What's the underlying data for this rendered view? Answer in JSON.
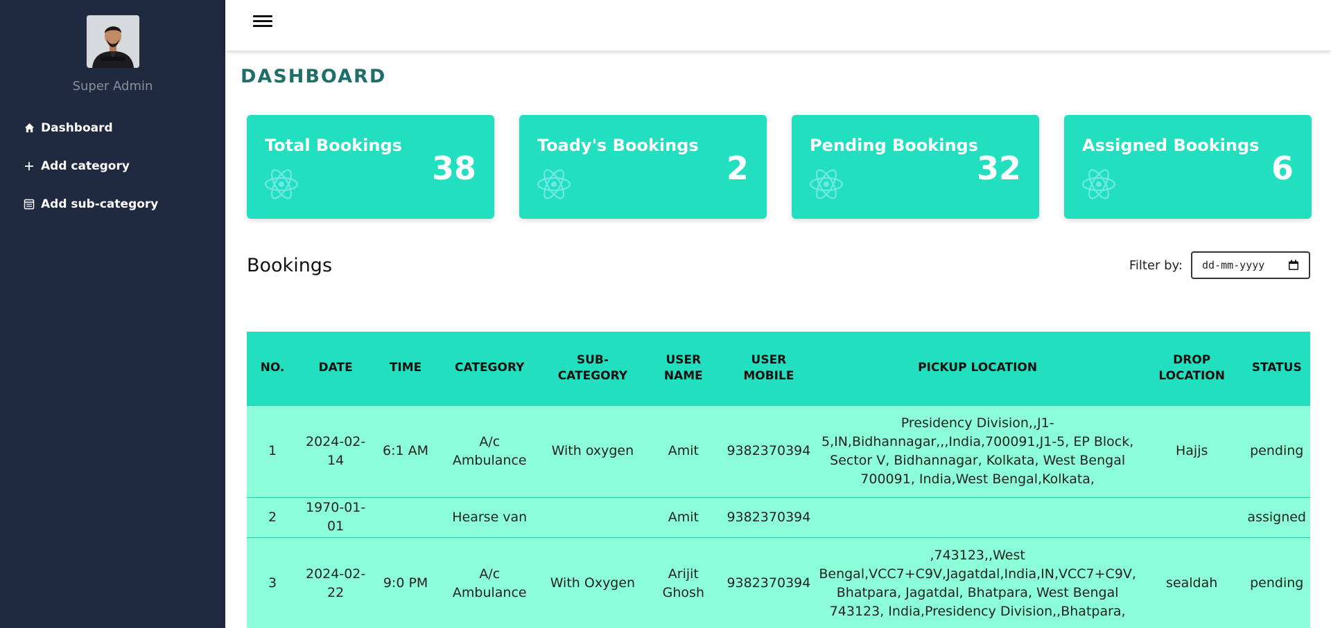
{
  "sidebar": {
    "role": "Super Admin",
    "items": [
      {
        "label": "Dashboard",
        "icon": "home-icon"
      },
      {
        "label": "Add category",
        "icon": "plus-icon"
      },
      {
        "label": "Add sub-category",
        "icon": "list-icon"
      }
    ]
  },
  "main": {
    "title": "DASHBOARD",
    "cards": [
      {
        "label": "Total Bookings",
        "count": "38"
      },
      {
        "label": "Toady's Bookings",
        "count": "2"
      },
      {
        "label": "Pending Bookings",
        "count": "32"
      },
      {
        "label": "Assigned Bookings",
        "count": "6"
      }
    ],
    "bookings_title": "Bookings",
    "filter": {
      "label": "Filter by:",
      "placeholder": "dd-mm-yyyy"
    },
    "table": {
      "headers": [
        "NO.",
        "DATE",
        "TIME",
        "CATEGORY",
        "SUB-CATEGORY",
        "USER NAME",
        "USER MOBILE",
        "PICKUP LOCATION",
        "DROP LOCATION",
        "STATUS"
      ],
      "rows": [
        [
          "1",
          "2024-02-14",
          "6:1 AM",
          "A/c Ambulance",
          "With oxygen",
          "Amit",
          "9382370394",
          "Presidency Division,,J1-5,IN,Bidhannagar,,,India,700091,J1-5, EP Block, Sector V, Bidhannagar, Kolkata, West Bengal 700091, India,West Bengal,Kolkata,",
          "Hajjs",
          "pending"
        ],
        [
          "2",
          "1970-01-01",
          "",
          "Hearse van",
          "",
          "Amit",
          "9382370394",
          "",
          "",
          "assigned"
        ],
        [
          "3",
          "2024-02-22",
          "9:0 PM",
          "A/c Ambulance",
          "With Oxygen",
          "Arijit Ghosh",
          "9382370394",
          ",743123,,West Bengal,VCC7+C9V,Jagatdal,India,IN,VCC7+C9V, Bhatpara, Jagatdal, Bhatpara, West Bengal 743123, India,Presidency Division,,Bhatpara,",
          "sealdah",
          "pending"
        ]
      ]
    }
  },
  "colors": {
    "sidebar_bg": "#1f2940",
    "accent": "#22dfbf",
    "row_bg": "#8bfdd8",
    "title": "#1f6e69"
  }
}
